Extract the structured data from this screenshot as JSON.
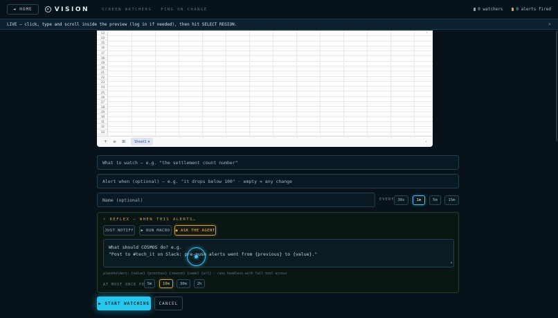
{
  "topbar": {
    "home_label": "◄ HOME",
    "logo_text": "VISION",
    "nav": [
      "SCREEN WATCHERS",
      "PING ON CHANGE"
    ],
    "watchers_label": "0 watchers",
    "alerts_label": "0 alerts fired",
    "watchers_dot_color": "#8fa3b0",
    "alerts_dot_color": "#d6a84a"
  },
  "banner": {
    "text": "LIVE — click, type and scroll inside the preview (log in if needed), then hit SELECT REGION.",
    "close": "×"
  },
  "preview": {
    "rows": [
      "13",
      "14",
      "15",
      "16",
      "17",
      "18",
      "19",
      "20",
      "21",
      "22",
      "23",
      "24",
      "25",
      "26",
      "27",
      "28",
      "29",
      "30",
      "31",
      "32",
      "33"
    ],
    "sheet_tab": "Sheet1",
    "sheet_add": "+",
    "sheet_list": "≡",
    "sheet_explore": "⊞",
    "right_icon": "›"
  },
  "form": {
    "watch_placeholder": "What to watch — e.g. \"the settlement count number\"",
    "alert_placeholder": "Alert when (optional) — e.g. \"it drops below 100\" · empty = any change",
    "name_placeholder": "Name (optional)",
    "every_label": "EVERY",
    "intervals": [
      "30s",
      "1m",
      "5m",
      "15m"
    ],
    "interval_selected": "1m"
  },
  "reflex": {
    "title": "⚡ REFLEX — WHEN THIS ALERTS…",
    "buttons": [
      "JUST NOTIFY",
      "▶ RUN MACRO",
      "◉ ASK THE AGENT"
    ],
    "selected": "◉ ASK THE AGENT",
    "agent_line1": "What should COSMOS do? e.g.",
    "agent_line2": "\"Post to #tech_it on Slack: pre-push alerts went from {previous} to {value}.\"",
    "placeholders_note": "placeholders: {value} {previous} {reason} {name} {url} · runs headless with full tool access",
    "atmost_label": "AT MOST ONCE PER",
    "cooldowns": [
      "5m",
      "10m",
      "30m",
      "2h"
    ],
    "cooldown_selected": "10m"
  },
  "actions": {
    "start_label": "▶ START WATCHING",
    "cancel_label": "CANCEL"
  }
}
